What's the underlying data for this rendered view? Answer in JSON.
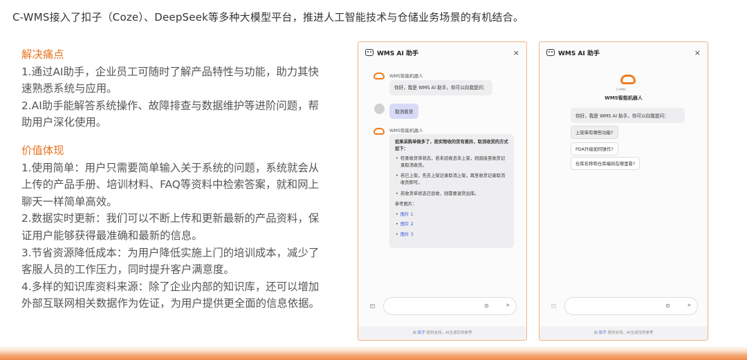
{
  "intro": "C-WMS接入了扣子（Coze）、DeepSeek等多种大模型平台，推进人工智能技术与仓储业务场景的有机结合。",
  "pain": {
    "heading": "解决痛点",
    "items": [
      "1.通过AI助手，企业员工可随时了解产品特性与功能，助力其快速熟悉系统与应用。",
      "2.AI助手能解答系统操作、故障排查与数据维护等进阶问题，帮助用户深化使用。"
    ]
  },
  "value": {
    "heading": "价值体现",
    "items": [
      "1.使用简单：用户只需要简单输入关于系统的问题，系统就会从上传的产品手册、培训材料、FAQ等资料中检索答案，就和网上聊天一样简单高效。",
      "2.数据实时更新：我们可以不断上传和更新最新的产品资料，保证用户能够获得最准确和最新的信息。",
      "3.节省资源降低成本：为用户降低实施上门的培训成本，减少了客服人员的工作压力，同时提升客户满意度。",
      "4.多样的知识库资料来源：除了企业内部的知识库，还可以增加外部互联网相关数据作为佐证，为用户提供更全面的信息依据。"
    ]
  },
  "chat1": {
    "title": "WMS AI 助手",
    "close": "×",
    "bot_name": "WMS智能机器人",
    "greeting": "你好，我是 WMS AI 助手，你可以向我提问：",
    "user_msg": "取消收货",
    "answer_q": "如果采购单做多了，按实物收的货有差异，取消收货的方式如下：",
    "answer_items": [
      "检查收货单状态，若未验收且未上架，则直接至收货记录取消收货。",
      "若已上架，先去上架记录取消上架，再至收货记录取消收货即可。",
      "若收货单状态已验收，则需要退货出库。"
    ],
    "ref_label": "参考图片：",
    "refs": [
      "图片 1",
      "图片 2",
      "图片 3"
    ],
    "footer_prefix": "由 ",
    "footer_brand": "扣子",
    "footer_suffix": " 提供支持，AI生成仅供参考"
  },
  "chat2": {
    "title": "WMS AI 助手",
    "close": "×",
    "logo_text": "C-WMS",
    "bot_name": "WMS智能机器人",
    "greeting": "你好，我是 WMS AI 助手，你可以向我提问：",
    "suggestions": [
      "上架单有哪些功能?",
      "PDA升级如何操作?",
      "仓库名称和仓库编码在哪里看?"
    ],
    "footer_prefix": "由 ",
    "footer_brand": "扣子",
    "footer_suffix": " 提供支持，AI生成仅供参考"
  },
  "colors": {
    "accent": "#e8731f",
    "panel_border": "#f3b382",
    "link": "#3b55d8"
  }
}
